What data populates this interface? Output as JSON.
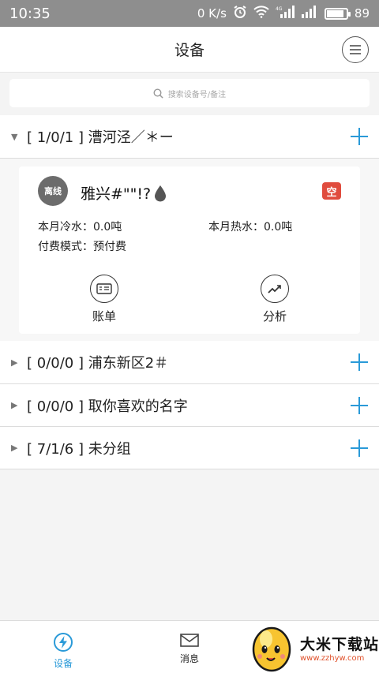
{
  "status_bar": {
    "time": "10:35",
    "net_speed": "0 K/s",
    "battery": "89",
    "battery_level": 0.89
  },
  "header": {
    "title": "设备"
  },
  "search": {
    "placeholder": "搜索设备号/备注"
  },
  "groups": [
    {
      "label": "[ 1/0/1 ] 漕河泾／＊ー",
      "expanded": true
    },
    {
      "label": "[ 0/0/0 ] 浦东新区2＃",
      "expanded": false
    },
    {
      "label": "[ 0/0/0 ] 取你喜欢的名字",
      "expanded": false
    },
    {
      "label": "[ 7/1/6 ] 未分组",
      "expanded": false
    }
  ],
  "device": {
    "status": "离线",
    "name": "雅兴#\"\"!?",
    "badge": "空",
    "cold_water": "本月冷水：0.0吨",
    "hot_water": "本月热水：0.0吨",
    "payment_mode": "付费模式：预付费",
    "actions": [
      {
        "label": "账单",
        "icon": "bill-icon"
      },
      {
        "label": "分析",
        "icon": "trend-chart-icon"
      }
    ]
  },
  "bottom_nav": [
    {
      "label": "设备",
      "icon": "lightning-icon",
      "active": true
    },
    {
      "label": "消息",
      "icon": "envelope-icon",
      "active": false
    }
  ],
  "watermark": {
    "title": "大米下载站",
    "url": "www.zzhyw.com"
  },
  "colors": {
    "accent": "#2a9ad8",
    "badge_red": "#e04c3e",
    "status_bar": "#8e8e8e"
  }
}
